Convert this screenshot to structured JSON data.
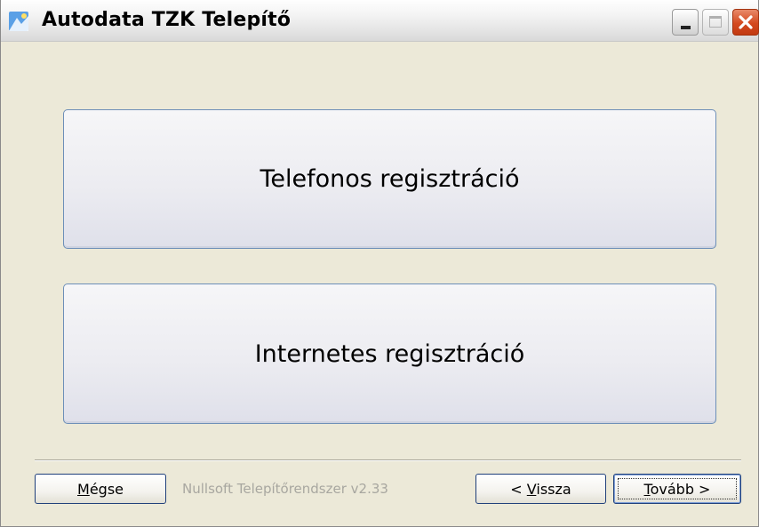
{
  "window": {
    "title": "Autodata TZK Telepítő",
    "controls": {
      "minimize": "minimize",
      "maximize": "maximize",
      "close": "close"
    }
  },
  "options": [
    {
      "label": "Telefonos regisztráció"
    },
    {
      "label": "Internetes regisztráció"
    }
  ],
  "footer": {
    "cancel_label": "Mégse",
    "cancel_hotkey": "M",
    "cancel_rest": "égse",
    "branding": "Nullsoft Telepítőrendszer v2.33",
    "back_prefix": "< ",
    "back_hotkey": "V",
    "back_rest": "issza",
    "back_label": "< Vissza",
    "next_hotkey": "T",
    "next_rest": "ovább >",
    "next_label": "Tovább >"
  },
  "icons": [
    "app-installer-icon",
    "minimize-icon",
    "maximize-icon",
    "close-icon"
  ],
  "colors": {
    "close_button": "#d4491f",
    "button_border": "#1f3f7a",
    "option_border": "#6d8fb8",
    "dialog_bg": "#ece9d8"
  }
}
